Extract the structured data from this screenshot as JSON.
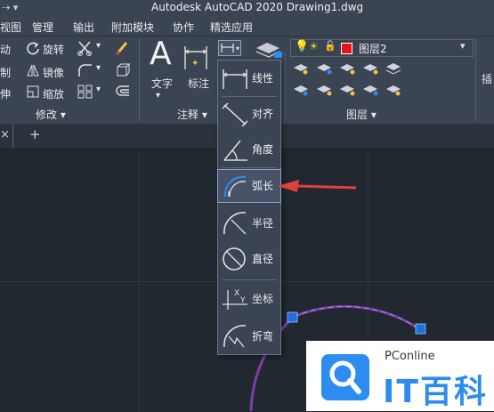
{
  "window": {
    "title": "Autodesk AutoCAD 2020    Drawing1.dwg"
  },
  "menu": [
    "视图",
    "管理",
    "输出",
    "附加模块",
    "协作",
    "精选应用"
  ],
  "ribbon": {
    "modify": {
      "move": "动",
      "rotate": "旋转",
      "copy": "制",
      "mirror": "镜像",
      "stretch": "伸",
      "scale": "缩放",
      "panel": "修改 ▾"
    },
    "annotation": {
      "text": "文字",
      "dimension": "标注",
      "panel": "注释 ▾"
    },
    "layers": {
      "current_layer": "图层2",
      "layer_color": "#e8141b",
      "panel": "图层 ▾"
    },
    "insert": "插"
  },
  "tabs": {
    "close": "×",
    "add": "+"
  },
  "dim_menu": [
    {
      "label": "线性"
    },
    {
      "label": "对齐"
    },
    {
      "label": "角度"
    },
    {
      "label": "弧长"
    },
    {
      "label": "半径"
    },
    {
      "label": "直径"
    },
    {
      "label": "坐标"
    },
    {
      "label": "折弯"
    }
  ],
  "watermark": {
    "brand": "PConline",
    "name": "IT百科"
  },
  "colors": {
    "arrow": "#e2403d",
    "grip": "#1e6fe0",
    "arc": "#7a3ea8",
    "accent_blue": "#2d8cf0"
  }
}
